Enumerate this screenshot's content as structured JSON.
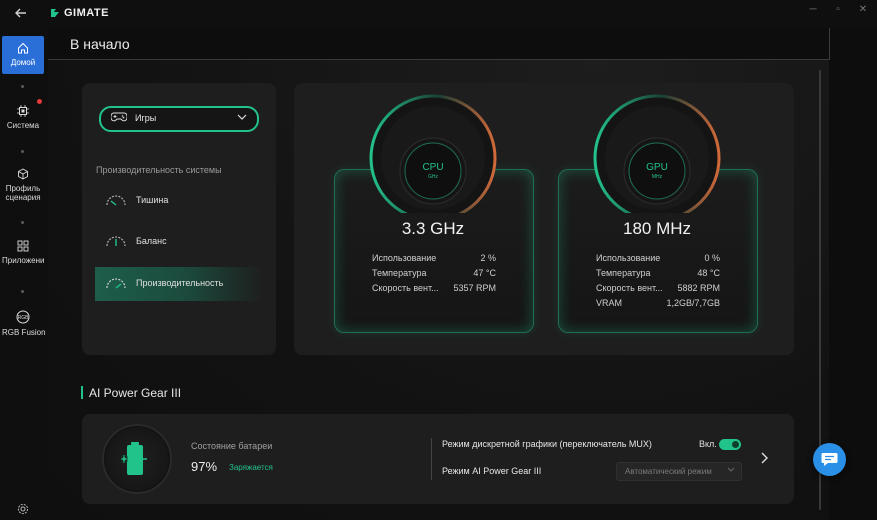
{
  "app": {
    "brand": "GIMATE"
  },
  "sidebar": {
    "items": [
      {
        "label": "Домой",
        "icon": "home-icon",
        "active": true
      },
      {
        "label": "Система",
        "icon": "chip-icon",
        "badge": true
      },
      {
        "label": "Профиль сценария",
        "icon": "cube-icon"
      },
      {
        "label": "Приложения",
        "icon": "apps-grid-icon"
      },
      {
        "label": "RGB Fusion",
        "icon": "rgb-fusion-icon"
      }
    ],
    "settings_icon": "gear-icon"
  },
  "page": {
    "title": "В начало"
  },
  "profile_panel": {
    "selected_mode": "Игры",
    "section_label": "Производительность системы",
    "options": [
      {
        "label": "Тишина",
        "active": false
      },
      {
        "label": "Баланс",
        "active": false
      },
      {
        "label": "Производительность",
        "active": true
      }
    ]
  },
  "cpu": {
    "name": "CPU",
    "unit": "GHz",
    "value": "3.3 GHz",
    "stats": [
      {
        "label": "Использование",
        "value": "2 %"
      },
      {
        "label": "Температура",
        "value": "47 °C"
      },
      {
        "label": "Скорость вент...",
        "value": "5357 RPM"
      }
    ]
  },
  "gpu": {
    "name": "GPU",
    "unit": "MHz",
    "value": "180 MHz",
    "stats": [
      {
        "label": "Использование",
        "value": "0 %"
      },
      {
        "label": "Температура",
        "value": "48 °C"
      },
      {
        "label": "Скорость вент...",
        "value": "5882 RPM"
      },
      {
        "label": "VRAM",
        "value": "1,2GB/7,7GB"
      }
    ]
  },
  "ai_power_gear": {
    "title": "AI Power Gear III",
    "battery_label": "Состояние батареи",
    "battery_percent": "97%",
    "battery_state": "Заряжается",
    "mux_label": "Режим дискретной графики (переключатель MUX)",
    "mux_state_label": "Вкл.",
    "mux_on": true,
    "gear_label": "Режим AI Power Gear III",
    "gear_value": "Автоматический режим"
  },
  "colors": {
    "accent": "#22c38a",
    "nav_active": "#2a6ed8",
    "chat_button": "#2a8fe6",
    "badge": "#e5393b"
  }
}
